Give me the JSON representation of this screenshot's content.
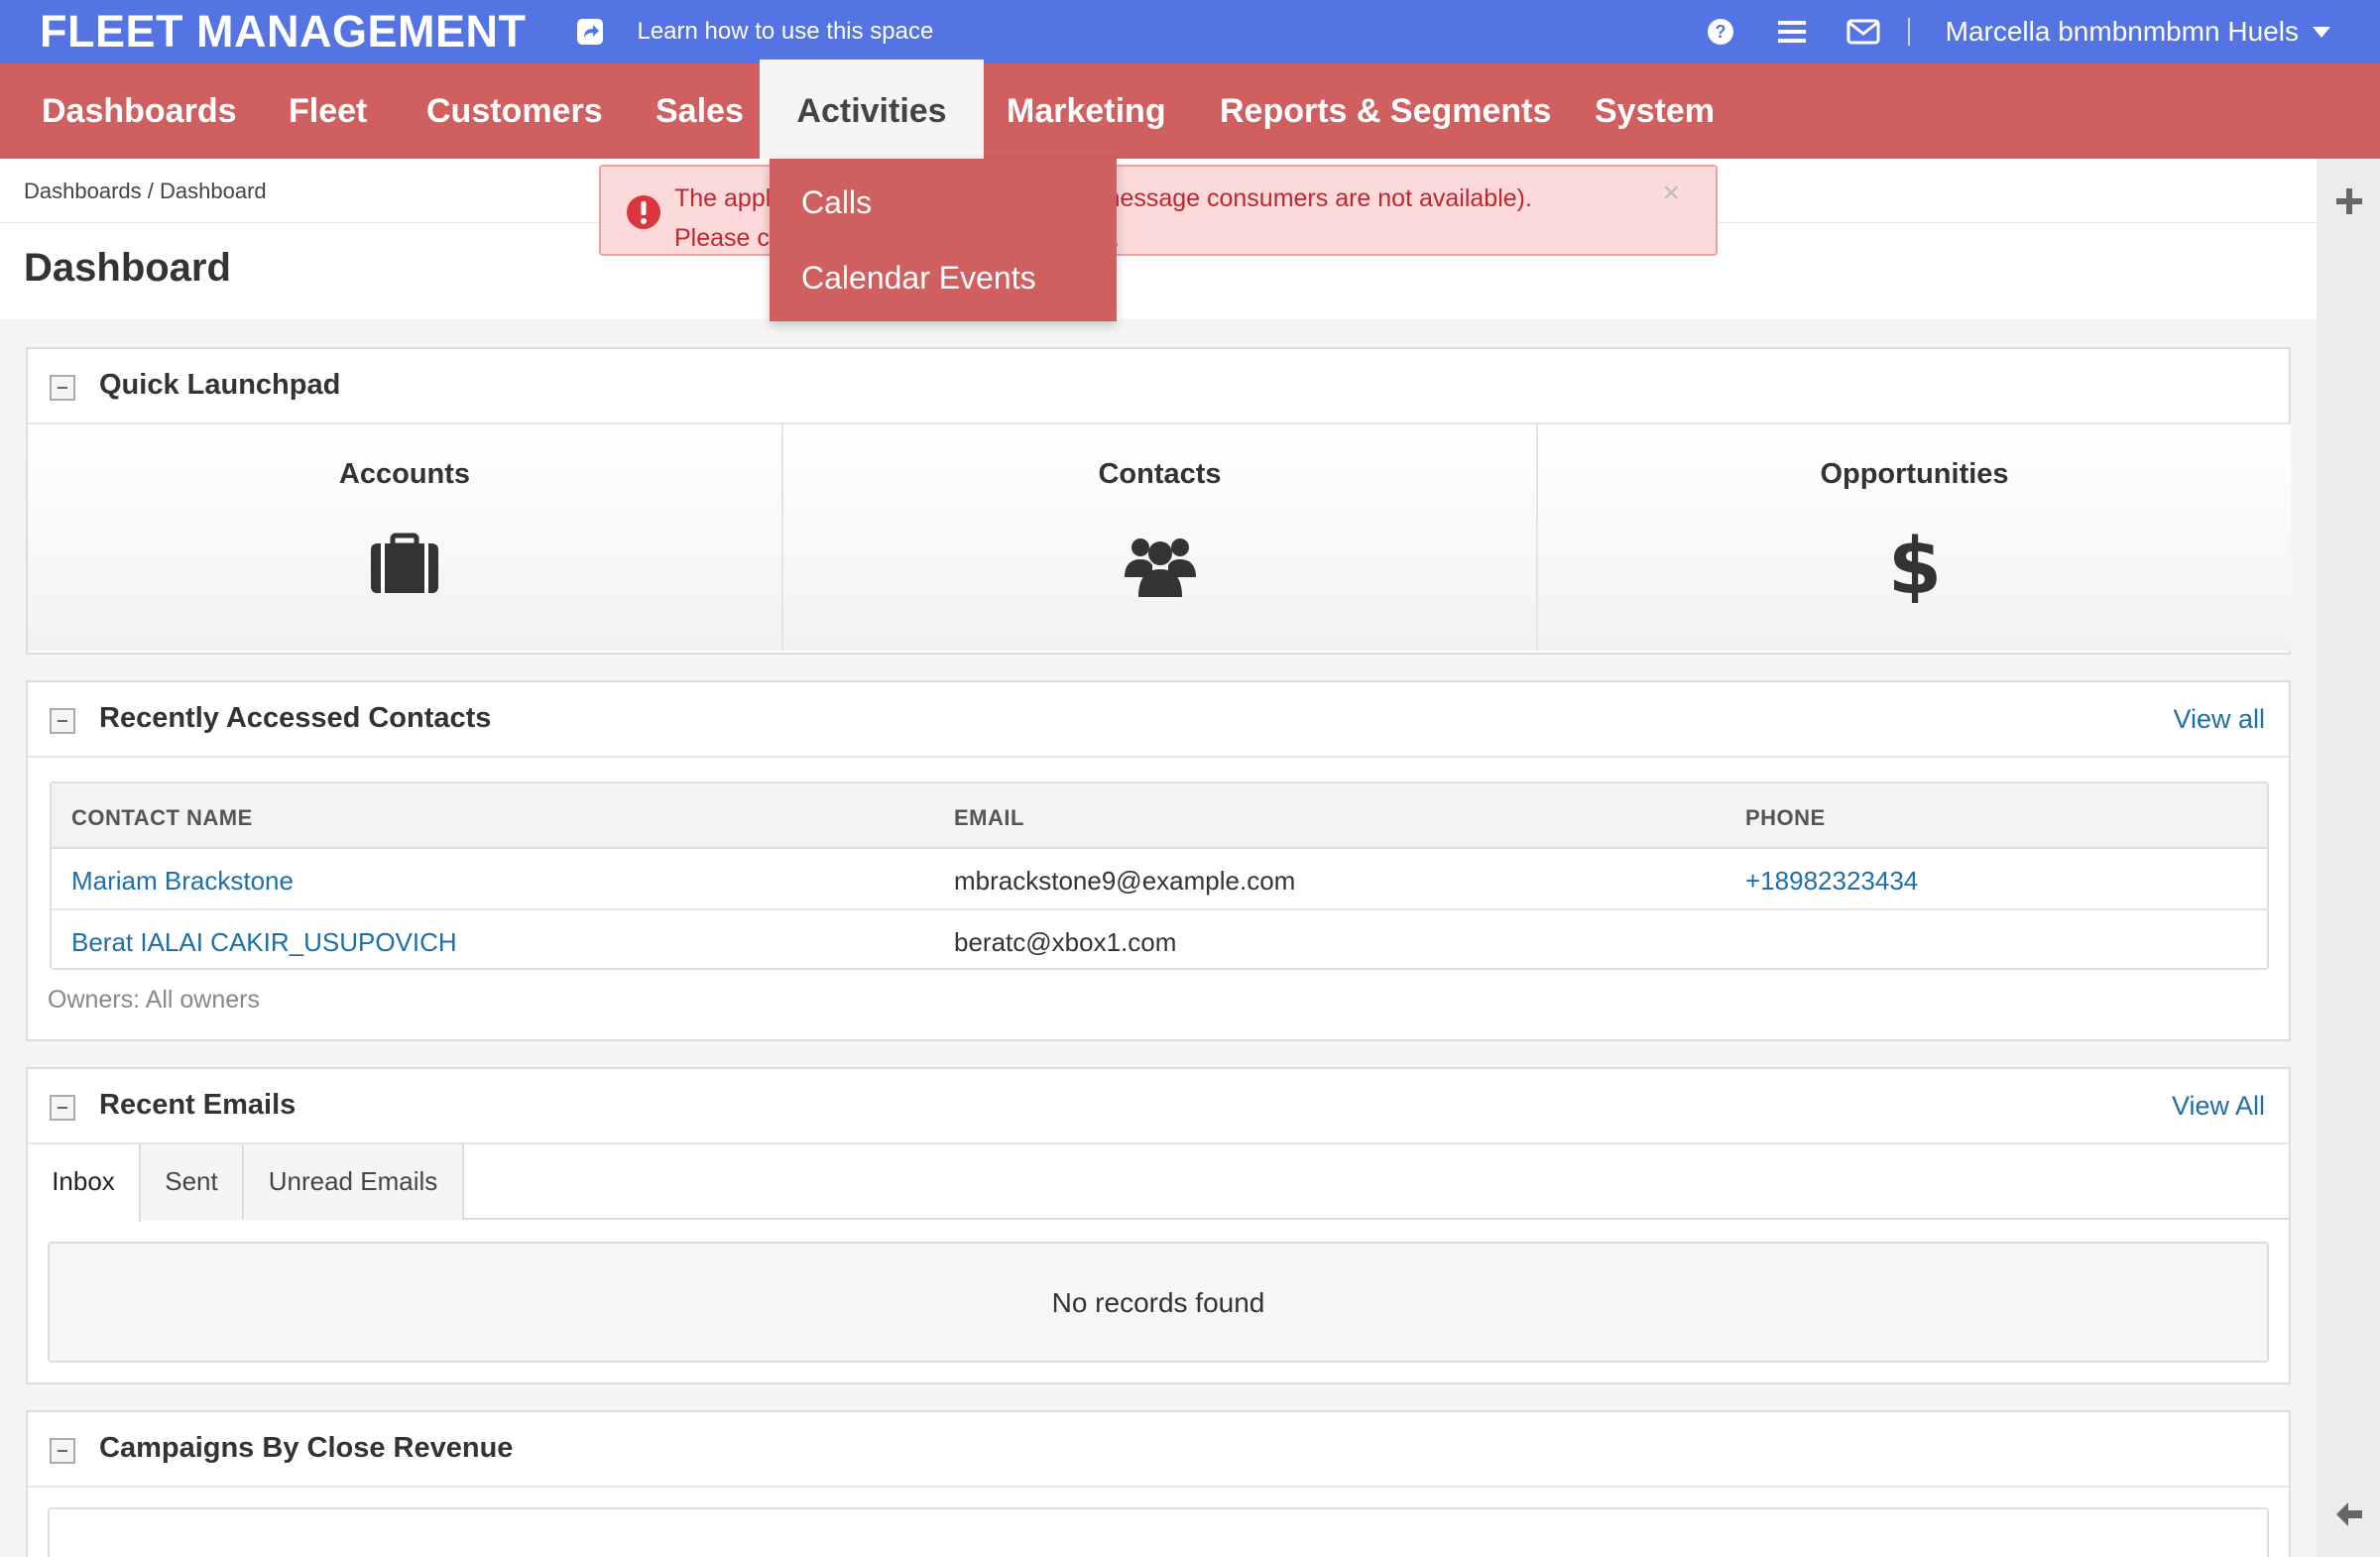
{
  "header": {
    "brand": "FLEET MANAGEMENT",
    "learn_link": "Learn how to use this space",
    "user_name": "Marcella bnmbnmbmn Huels"
  },
  "nav": {
    "items": [
      {
        "label": "Dashboards"
      },
      {
        "label": "Fleet"
      },
      {
        "label": "Customers"
      },
      {
        "label": "Sales"
      },
      {
        "label": "Activities"
      },
      {
        "label": "Marketing"
      },
      {
        "label": "Reports & Segments"
      },
      {
        "label": "System"
      }
    ],
    "active": "Activities",
    "dropdown": [
      "Calls",
      "Calendar Events"
    ]
  },
  "breadcrumb": {
    "root": "Dashboards",
    "sep": "/",
    "current": "Dashboard"
  },
  "page_title": "Dashboard",
  "alert": {
    "line1": "The application doesn't work properly (message consumers are not available).",
    "line2": "Please contact the system administrator."
  },
  "launchpad": {
    "title": "Quick Launchpad",
    "items": [
      {
        "label": "Accounts",
        "icon": "briefcase-icon"
      },
      {
        "label": "Contacts",
        "icon": "users-icon"
      },
      {
        "label": "Opportunities",
        "icon": "dollar-icon"
      }
    ]
  },
  "contacts": {
    "title": "Recently Accessed Contacts",
    "view_all": "View all",
    "columns": [
      "CONTACT NAME",
      "EMAIL",
      "PHONE"
    ],
    "rows": [
      {
        "name": "Mariam Brackstone",
        "email": "mbrackstone9@example.com",
        "phone": "+18982323434"
      },
      {
        "name": "Berat IALAI CAKIR_USUPOVICH",
        "email": "beratc@xbox1.com",
        "phone": ""
      }
    ],
    "owners": "Owners: All owners"
  },
  "emails": {
    "title": "Recent Emails",
    "view_all": "View All",
    "tabs": [
      "Inbox",
      "Sent",
      "Unread Emails"
    ],
    "empty": "No records found"
  },
  "campaigns": {
    "title": "Campaigns By Close Revenue"
  },
  "colors": {
    "header": "#5474e3",
    "nav": "#d0605f",
    "link": "#1e6fa8",
    "alert_text": "#c0272d"
  }
}
